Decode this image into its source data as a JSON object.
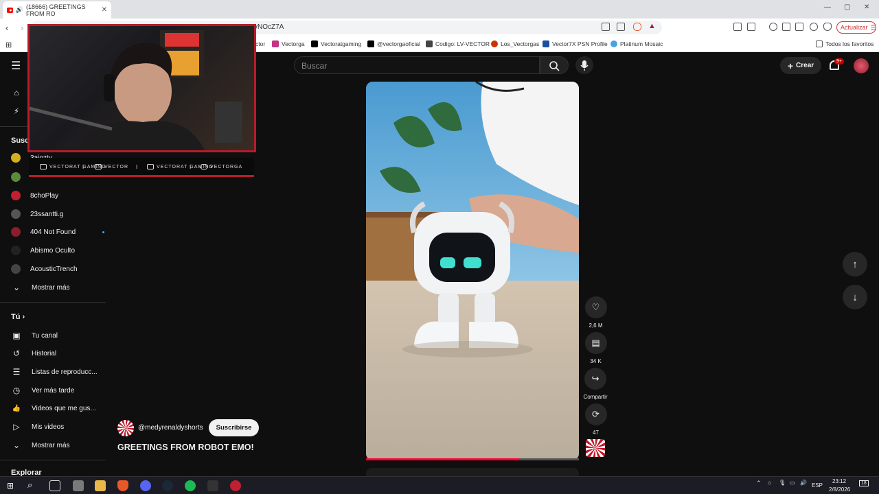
{
  "browser": {
    "tab_title": "(18666) GREETINGS FROM RO",
    "tab_close": "✕",
    "url_fragment": "vNOcZ7A",
    "update_label": "Actualizar",
    "window_controls": [
      "—",
      "▢",
      "✕"
    ],
    "bookmarks": [
      {
        "label": "ctor",
        "color": "#555555"
      },
      {
        "label": "Vectorga",
        "color": "#c13584"
      },
      {
        "label": "Vectoratgaming",
        "color": "#000000"
      },
      {
        "label": "@vectorgaoficial",
        "color": "#000000"
      },
      {
        "label": "Codigo: LV-VECTOR",
        "color": "#444444"
      },
      {
        "label": "Los_Vectorgas",
        "color": "#cc3300"
      },
      {
        "label": "Vector7X PSN Profile",
        "color": "#1b4fa0"
      },
      {
        "label": "Platinum Mosaic",
        "color": "#4aa3df"
      }
    ],
    "all_favorites": "Todos los favoritos"
  },
  "youtube": {
    "search_placeholder": "Buscar",
    "create_label": "Crear",
    "notif_badge": "9+",
    "sidebar": {
      "subs_title": "Susc",
      "channels": [
        {
          "name": "3aiozty",
          "color": "#d4b020"
        },
        {
          "name": "",
          "color": "#5a8a3a"
        },
        {
          "name": "8choPlay",
          "color": "#c02030"
        },
        {
          "name": "23ssantti.g",
          "color": "#555555"
        },
        {
          "name": "404 Not Found",
          "color": "#8a1e2a",
          "dot": true
        },
        {
          "name": "Abismo Oculto",
          "color": "#222222"
        },
        {
          "name": "AcousticTrench",
          "color": "#444444"
        }
      ],
      "show_more": "Mostrar más",
      "you_title": "Tú",
      "you_items": [
        {
          "label": "Tu canal",
          "icon": "▣"
        },
        {
          "label": "Historial",
          "icon": "↺"
        },
        {
          "label": "Listas de reproducc...",
          "icon": "☰"
        },
        {
          "label": "Ver más tarde",
          "icon": "◷"
        },
        {
          "label": "Videos que me gus...",
          "icon": "👍"
        },
        {
          "label": "Mis videos",
          "icon": "▷"
        }
      ],
      "show_more_2": "Mostrar más",
      "explore_title": "Explorar"
    },
    "overlay": {
      "links": [
        "VECTORAT GAMING",
        "VECTOR",
        "VECTORAT GAMING",
        "VECTORGA"
      ]
    },
    "short": {
      "channel": "@medyrenaldyshorts",
      "subscribe": "Suscribirse",
      "title": "GREETINGS FROM ROBOT EMO!",
      "progress": 0.72,
      "likes": "2,6 M",
      "comments": "34 K",
      "share": "Compartir",
      "remix": "47"
    }
  },
  "taskbar": {
    "lang": "ESP",
    "time": "23:12",
    "date": "2/8/2026",
    "notif": "18"
  }
}
